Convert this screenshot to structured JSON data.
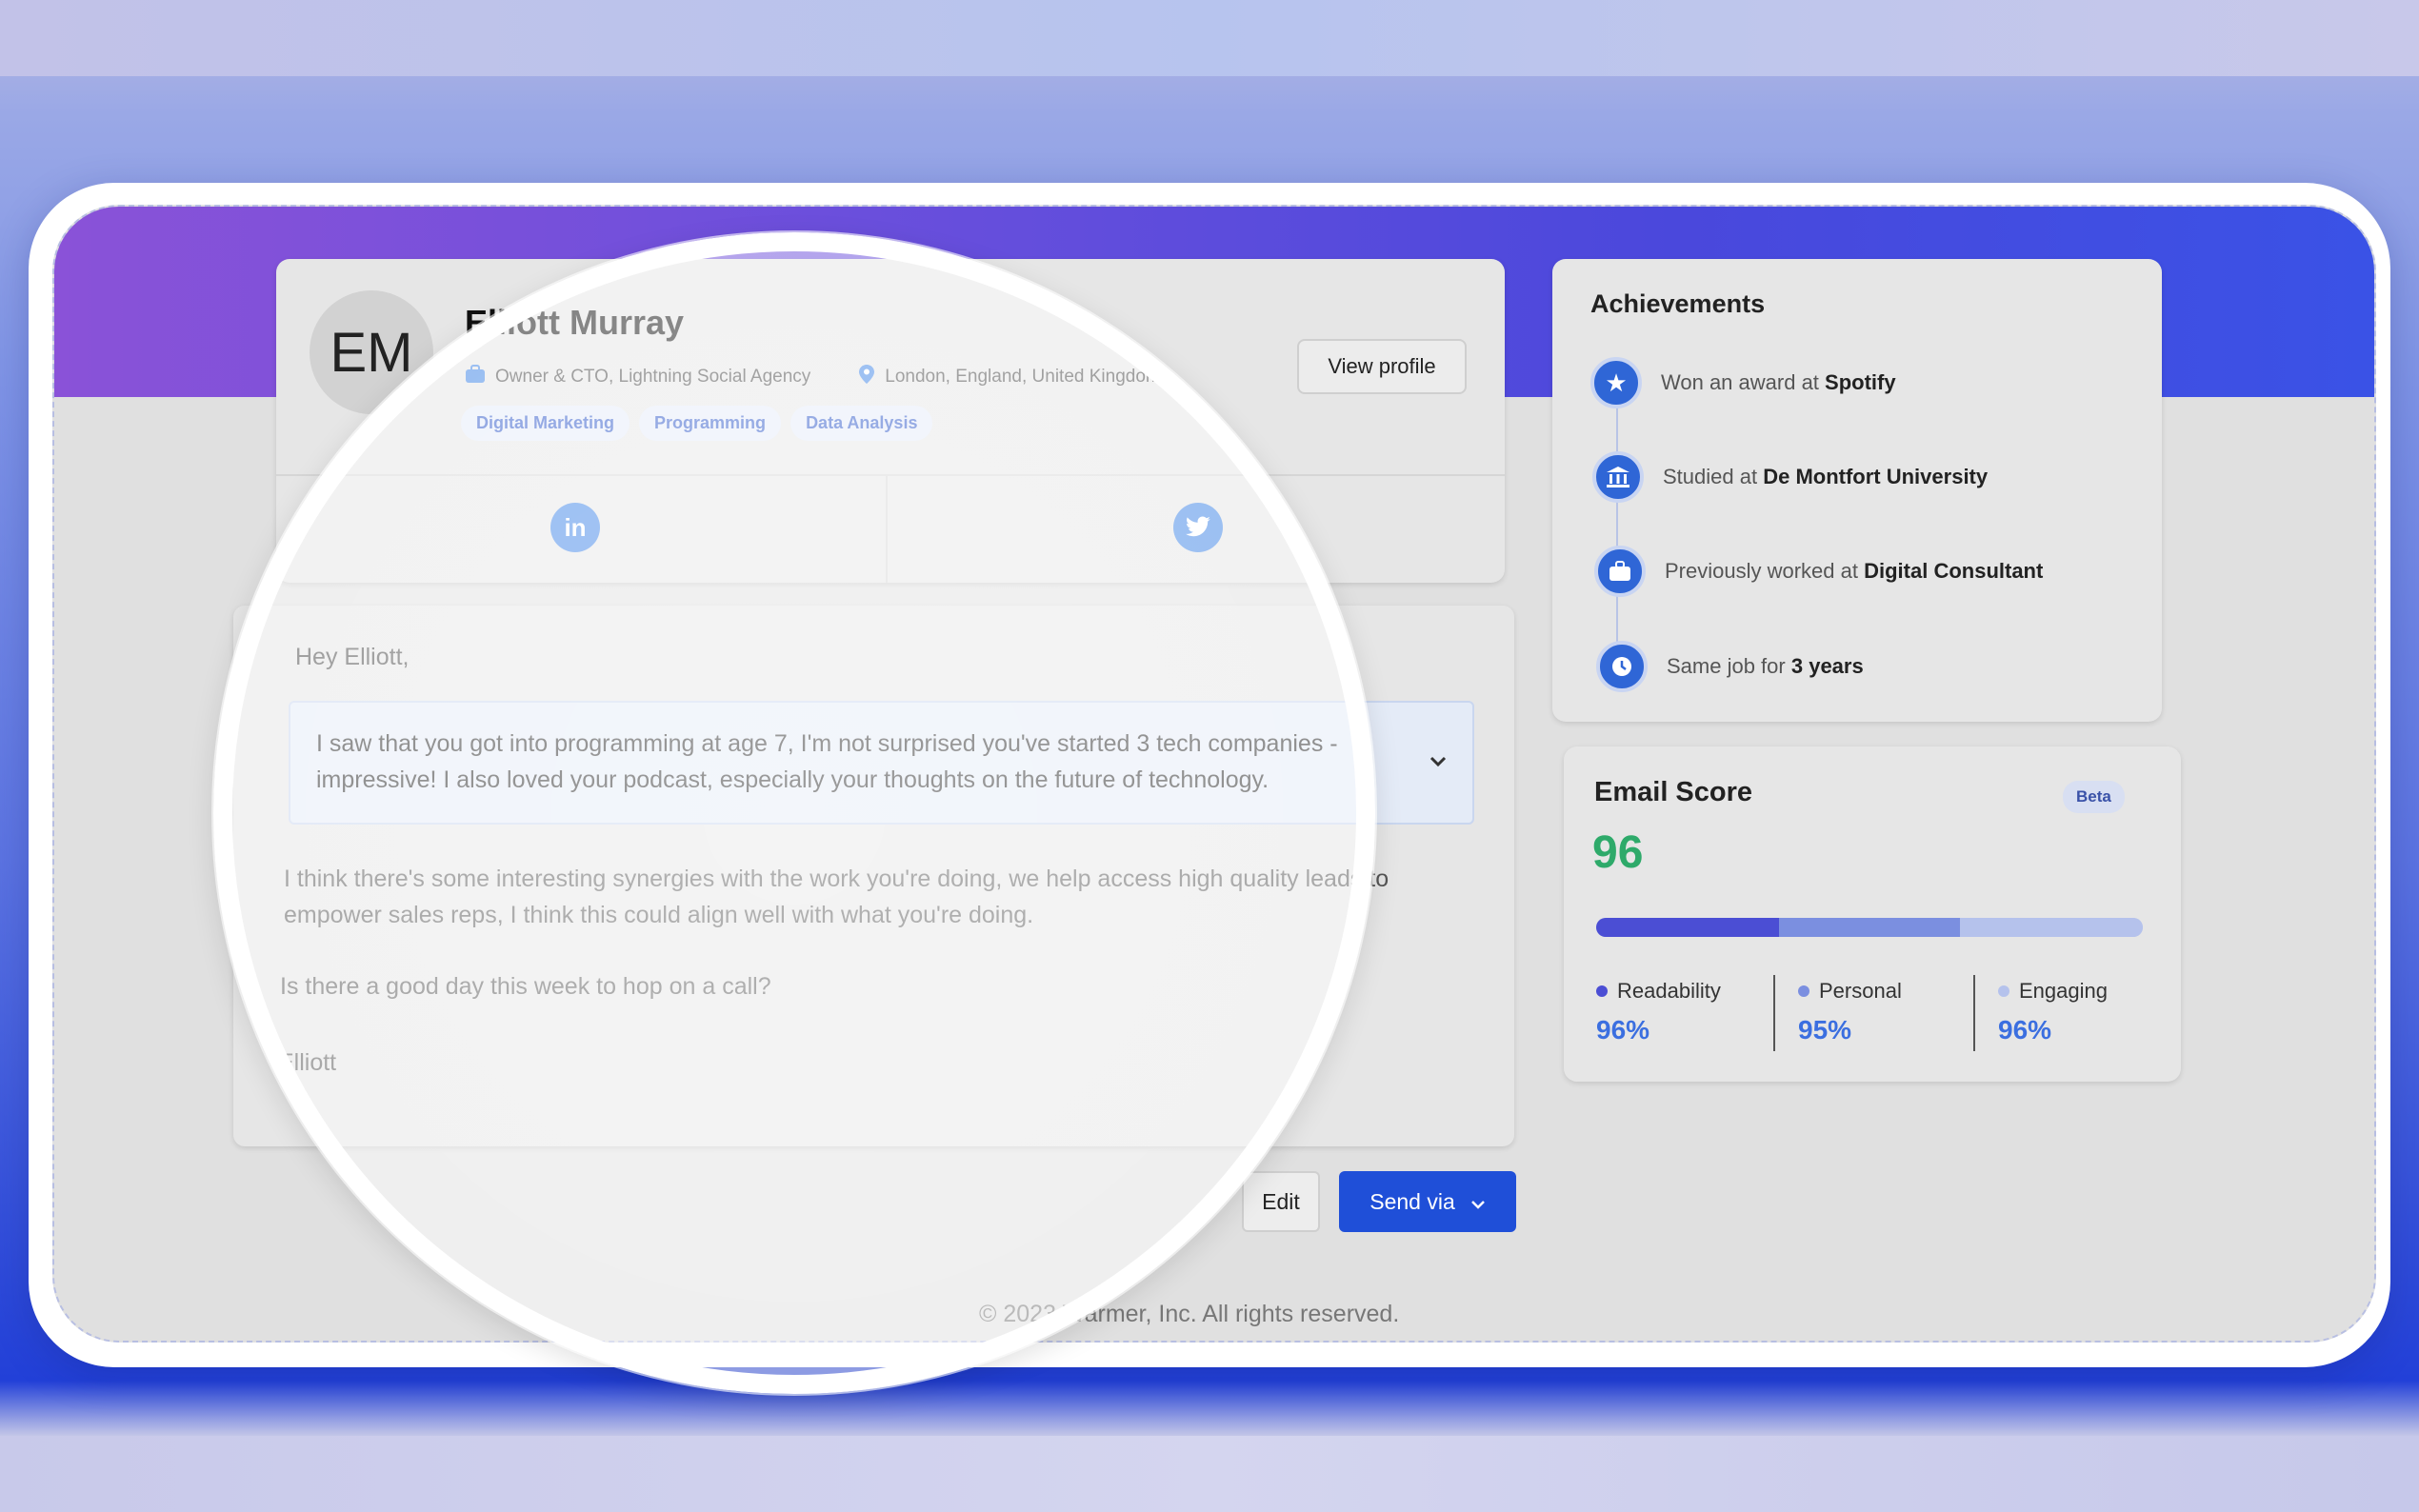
{
  "profile": {
    "initials": "EM",
    "name": "Elliott Murray",
    "role": "Owner & CTO, Lightning Social Agency",
    "location": "London, England, United Kingdom",
    "tags": [
      "Digital Marketing",
      "Programming",
      "Data Analysis"
    ],
    "view_profile_label": "View profile",
    "social": [
      "linkedin",
      "twitter"
    ]
  },
  "email": {
    "greeting": "Hey Elliott,",
    "highlight": "I saw that you got into programming at age 7, I'm not surprised you've started 3 tech companies - impressive! I also loved your podcast, especially your thoughts on the future of technology.",
    "paragraph": "I think there's some interesting synergies with the work you're doing, we help access high quality leads to empower sales reps, I think this could align well with what you're doing.",
    "question": "Is there a good day this week to hop on a call?",
    "signoff": "Elliott",
    "edit_label": "Edit",
    "send_label": "Send via"
  },
  "achievements": {
    "title": "Achievements",
    "items": [
      {
        "icon": "star-icon",
        "prefix": "Won an award at",
        "value": "Spotify"
      },
      {
        "icon": "university-icon",
        "prefix": "Studied at",
        "value": "De Montfort University"
      },
      {
        "icon": "briefcase-icon",
        "prefix": "Previously worked at",
        "value": "Digital Consultant"
      },
      {
        "icon": "clock-icon",
        "prefix": "Same job for",
        "value": "3 years"
      }
    ]
  },
  "email_score": {
    "title": "Email Score",
    "badge": "Beta",
    "score": "96",
    "metrics": [
      {
        "label": "Readability",
        "value": "96%",
        "color": "#4b4ed4"
      },
      {
        "label": "Personal",
        "value": "95%",
        "color": "#7b8fe0"
      },
      {
        "label": "Engaging",
        "value": "96%",
        "color": "#b5c2ec"
      }
    ]
  },
  "footer": "© 2023 Warmer, Inc. All rights reserved."
}
